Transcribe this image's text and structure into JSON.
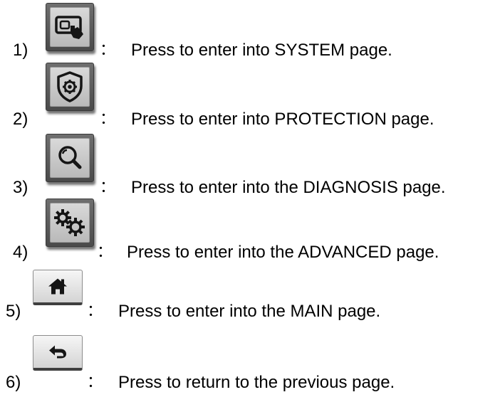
{
  "items": [
    {
      "number": "1)",
      "colon": "：",
      "text": "Press to enter into SYSTEM page.",
      "icon": "touch-screen-icon"
    },
    {
      "number": "2)",
      "colon": "：",
      "text": "Press to enter into PROTECTION page.",
      "icon": "shield-gear-icon"
    },
    {
      "number": "3)",
      "colon": "：",
      "text": "Press to enter into the DIAGNOSIS page.",
      "icon": "magnifier-icon"
    },
    {
      "number": "4)",
      "colon": "：",
      "text": "Press to enter into the ADVANCED page.",
      "icon": "gears-icon"
    },
    {
      "number": "5)",
      "colon": "：",
      "text": "Press to enter into the MAIN page.",
      "icon": "home-icon"
    },
    {
      "number": "6)",
      "colon": "：",
      "text": "Press to return to the previous page.",
      "icon": "return-arrow-icon"
    }
  ]
}
